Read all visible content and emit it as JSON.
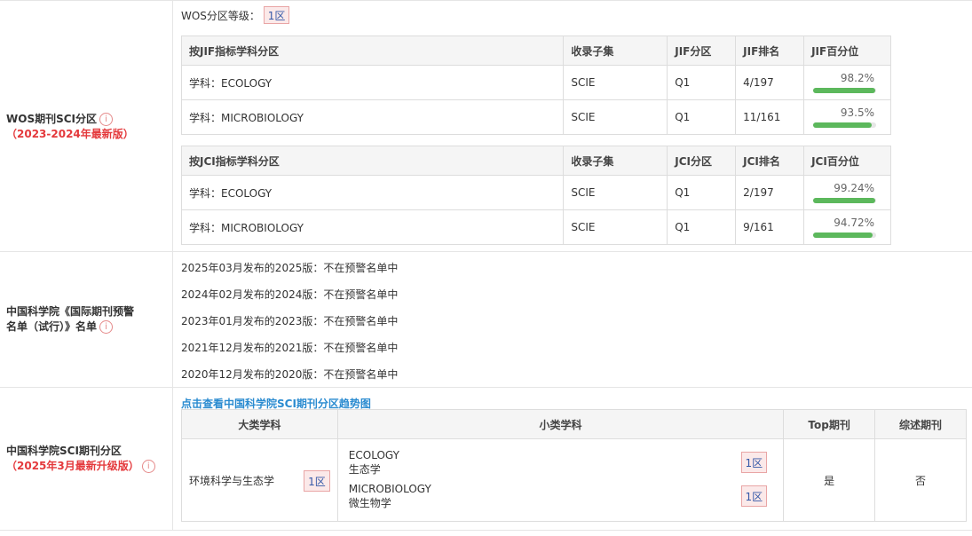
{
  "wos": {
    "label": "WOS期刊SCI分区",
    "sublabel": "（2023-2024年最新版）",
    "level_label": "WOS分区等级：",
    "level_value": "1区",
    "jif_table": {
      "headers": [
        "按JIF指标学科分区",
        "收录子集",
        "JIF分区",
        "JIF排名",
        "JIF百分位"
      ],
      "rows": [
        {
          "subject": "学科：ECOLOGY",
          "subset": "SCIE",
          "quartile": "Q1",
          "rank": "4/197",
          "percentile": "98.2%",
          "pct": 98.2
        },
        {
          "subject": "学科：MICROBIOLOGY",
          "subset": "SCIE",
          "quartile": "Q1",
          "rank": "11/161",
          "percentile": "93.5%",
          "pct": 93.5
        }
      ]
    },
    "jci_table": {
      "headers": [
        "按JCI指标学科分区",
        "收录子集",
        "JCI分区",
        "JCI排名",
        "JCI百分位"
      ],
      "rows": [
        {
          "subject": "学科：ECOLOGY",
          "subset": "SCIE",
          "quartile": "Q1",
          "rank": "2/197",
          "percentile": "99.24%",
          "pct": 99.24
        },
        {
          "subject": "学科：MICROBIOLOGY",
          "subset": "SCIE",
          "quartile": "Q1",
          "rank": "9/161",
          "percentile": "94.72%",
          "pct": 94.72
        }
      ]
    }
  },
  "warning": {
    "label_line1": "中国科学院《国际期刊预警",
    "label_line2": "名单（试行）》名单",
    "lines": [
      "2025年03月发布的2025版：不在预警名单中",
      "2024年02月发布的2024版：不在预警名单中",
      "2023年01月发布的2023版：不在预警名单中",
      "2021年12月发布的2021版：不在预警名单中",
      "2020年12月发布的2020版：不在预警名单中"
    ]
  },
  "cas": {
    "label": "中国科学院SCI期刊分区",
    "sublabel": "（2025年3月最新升级版）",
    "link": "点击查看中国科学院SCI期刊分区趋势图",
    "headers": [
      "大类学科",
      "小类学科",
      "Top期刊",
      "综述期刊"
    ],
    "major": "环境科学与生态学",
    "major_zone": "1区",
    "minors": [
      {
        "en": "ECOLOGY",
        "cn": "生态学",
        "zone": "1区"
      },
      {
        "en": "MICROBIOLOGY",
        "cn": "微生物学",
        "zone": "1区"
      }
    ],
    "top": "是",
    "review": "否"
  },
  "info_icon": "i"
}
